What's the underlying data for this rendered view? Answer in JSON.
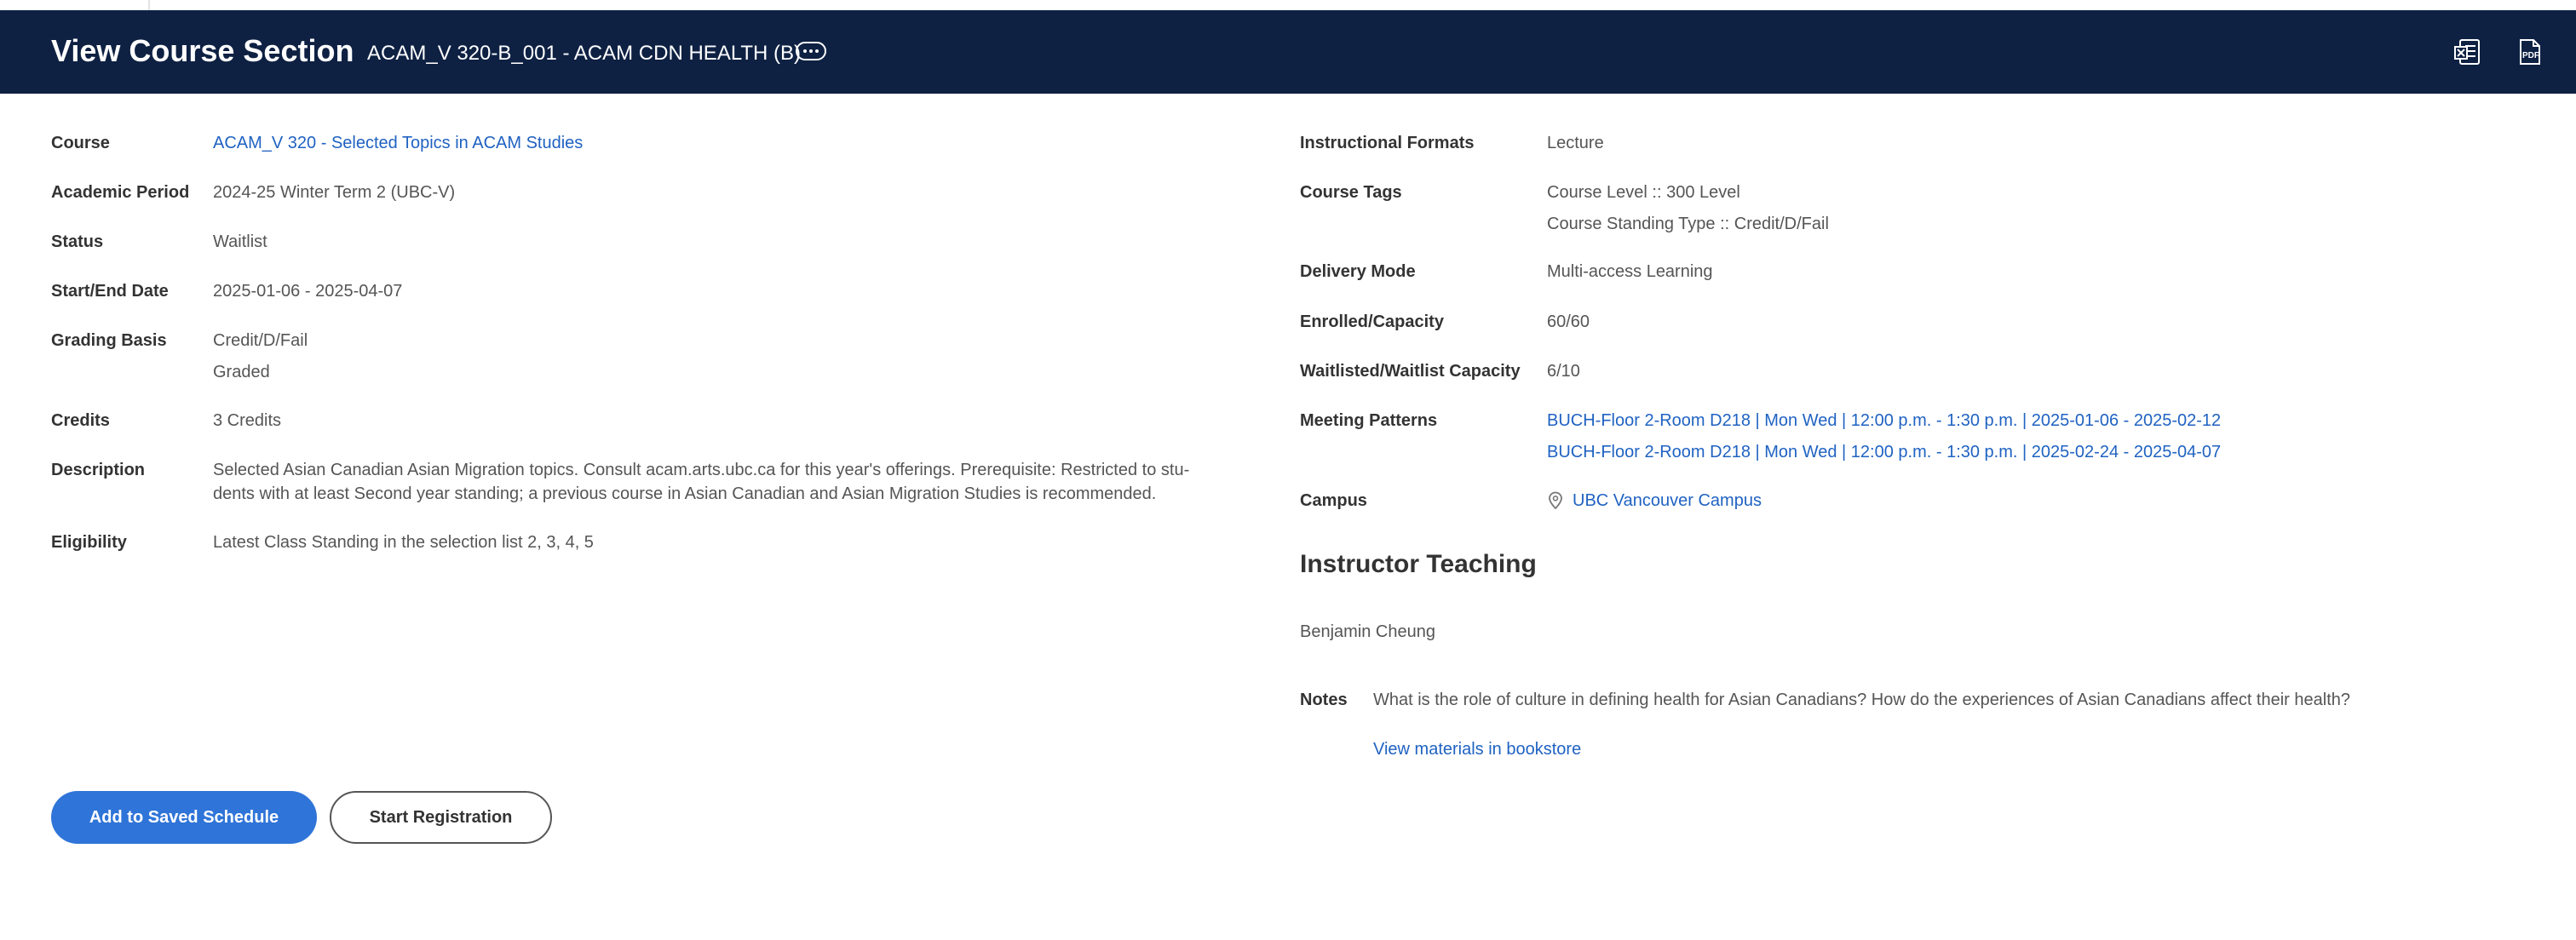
{
  "header": {
    "title": "View Course Section",
    "subtitle": "ACAM_V 320-B_001 - ACAM CDN HEALTH (B)"
  },
  "left": {
    "course": {
      "label": "Course",
      "value": "ACAM_V 320 - Selected Topics in ACAM Studies"
    },
    "academic_period": {
      "label": "Academic Period",
      "value": "2024-25 Winter Term 2 (UBC-V)"
    },
    "status": {
      "label": "Status",
      "value": "Waitlist"
    },
    "start_end_date": {
      "label": "Start/End Date",
      "value": "2025-01-06 - 2025-04-07"
    },
    "grading_basis": {
      "label": "Grading Basis",
      "values": [
        "Credit/D/Fail",
        "Graded"
      ]
    },
    "credits": {
      "label": "Credits",
      "value": "3 Credits"
    },
    "description": {
      "label": "Description",
      "lines": [
        "Selected Asian Canadian Asian Migration topics. Consult acam.arts.ubc.ca for this year's offerings. Prerequisite: Restricted to stu-",
        "dents with at least Second year standing; a previous course in Asian Canadian and Asian Migration Studies is recommended."
      ]
    },
    "eligibility": {
      "label": "Eligibility",
      "value": "Latest Class Standing in the selection list 2, 3, 4, 5"
    }
  },
  "right": {
    "instructional_formats": {
      "label": "Instructional Formats",
      "value": "Lecture"
    },
    "course_tags": {
      "label": "Course Tags",
      "values": [
        "Course Level :: 300 Level",
        "Course Standing Type :: Credit/D/Fail"
      ]
    },
    "delivery_mode": {
      "label": "Delivery Mode",
      "value": "Multi-access Learning"
    },
    "enrolled_capacity": {
      "label": "Enrolled/Capacity",
      "value": "60/60"
    },
    "waitlist": {
      "label": "Waitlisted/Waitlist Capacity",
      "value": "6/10"
    },
    "meeting_patterns": {
      "label": "Meeting Patterns",
      "values": [
        "BUCH-Floor 2-Room D218 | Mon Wed | 12:00 p.m. - 1:30 p.m. | 2025-01-06 - 2025-02-12",
        "BUCH-Floor 2-Room D218 | Mon Wed | 12:00 p.m. - 1:30 p.m. | 2025-02-24 - 2025-04-07"
      ]
    },
    "campus": {
      "label": "Campus",
      "value": "UBC Vancouver Campus"
    }
  },
  "instructor": {
    "section_title": "Instructor Teaching",
    "name": "Benjamin Cheung"
  },
  "notes": {
    "label": "Notes",
    "text": "What is the role of culture in defining health for Asian Canadians? How do the experiences of Asian Canadians affect their health?",
    "link": "View materials in bookstore"
  },
  "buttons": {
    "add_saved": "Add to Saved Schedule",
    "start_registration": "Start Registration"
  },
  "icons": {
    "more": "more-options-icon",
    "excel": "excel-export-icon",
    "pdf": "pdf-export-icon",
    "location": "location-pin-icon"
  },
  "colors": {
    "header_bg": "#0e2143",
    "link": "#1f62c2",
    "primary_button": "#2f74d8"
  }
}
